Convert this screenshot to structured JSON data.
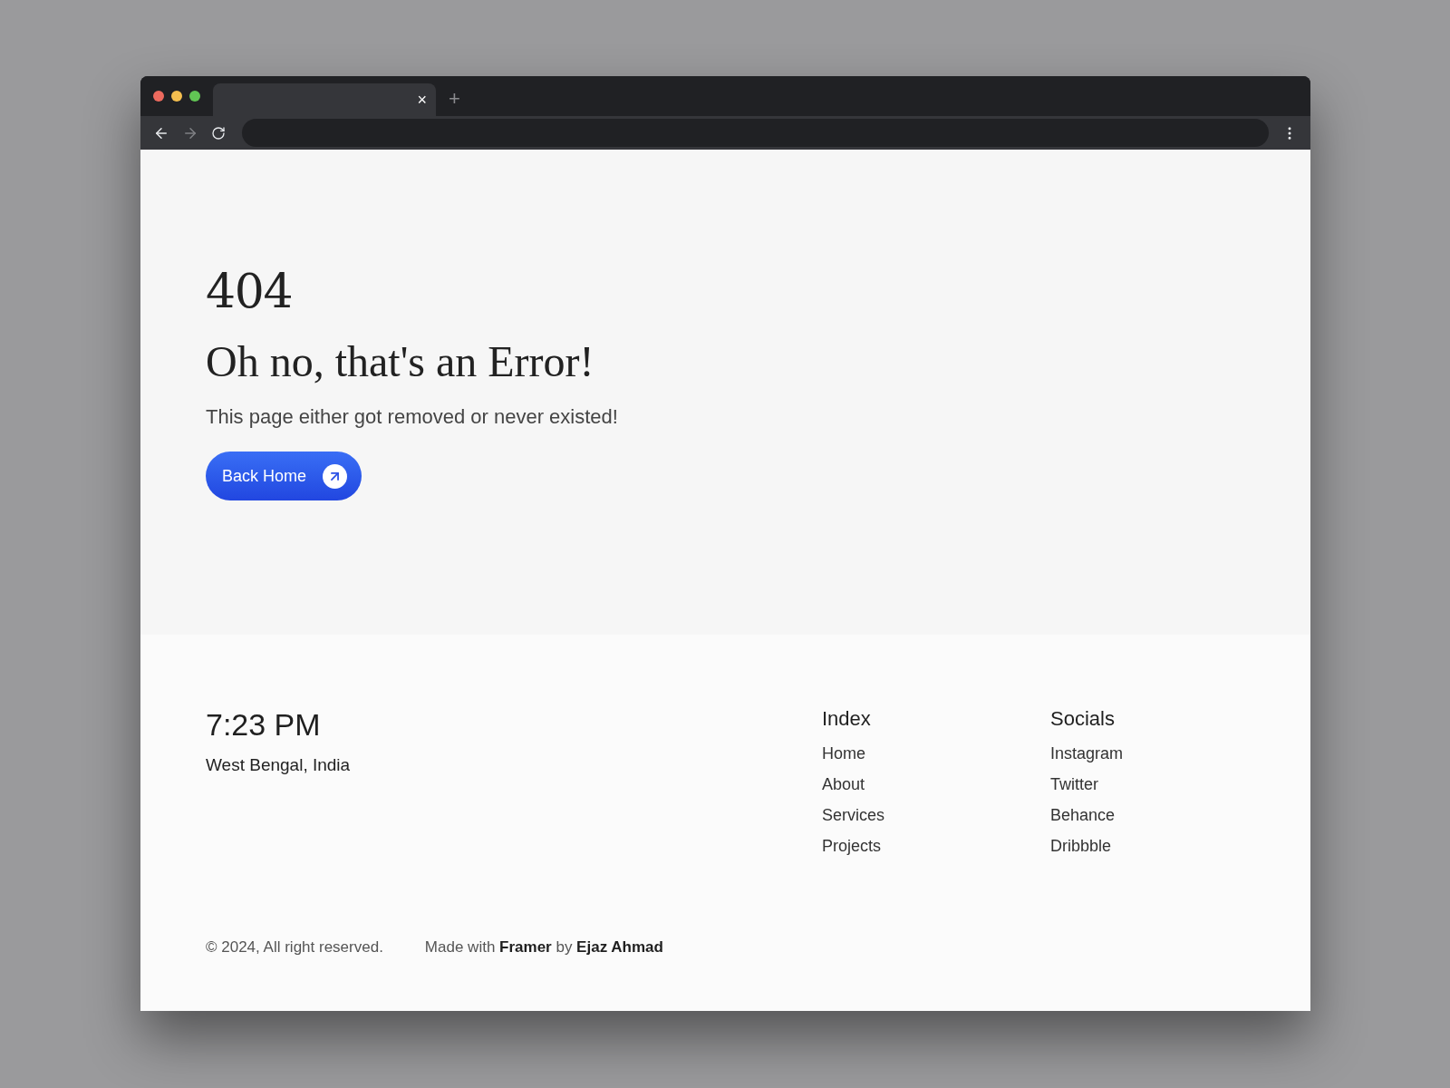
{
  "browser": {
    "tab_close": "×",
    "new_tab": "+"
  },
  "error": {
    "code": "404",
    "heading": "Oh no, that's an Error!",
    "message": "This page either got removed or never existed!",
    "button": "Back Home"
  },
  "footer": {
    "time": "7:23 PM",
    "location": "West Bengal, India",
    "columns": [
      {
        "title": "Index",
        "links": [
          "Home",
          "About",
          "Services",
          "Projects"
        ]
      },
      {
        "title": "Socials",
        "links": [
          "Instagram",
          "Twitter",
          "Behance",
          "Dribbble"
        ]
      }
    ],
    "copyright": "© 2024, All right reserved.",
    "credit": "Made with **Framer** by **Ejaz Ahmad**"
  }
}
